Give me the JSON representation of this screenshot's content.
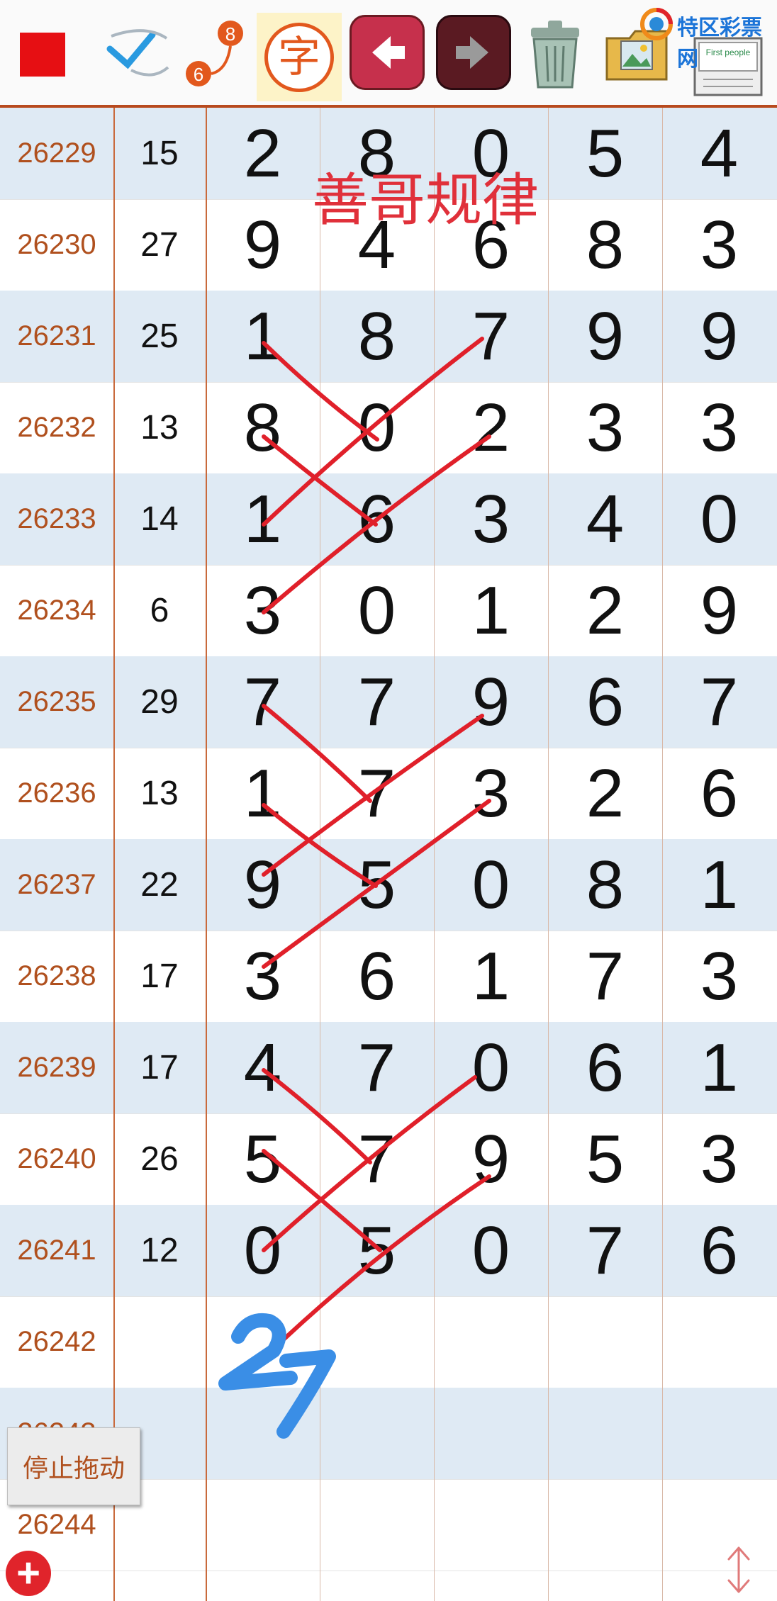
{
  "toolbar": {
    "items": [
      {
        "icon": "red-square-icon"
      },
      {
        "icon": "check-pen-icon"
      },
      {
        "icon": "range-icon",
        "label_top": "8",
        "label_bottom": "6"
      },
      {
        "icon": "character-icon",
        "label": "字"
      },
      {
        "icon": "back-arrow-icon"
      },
      {
        "icon": "forward-arrow-icon"
      },
      {
        "icon": "trash-icon"
      },
      {
        "icon": "photo-folder-icon"
      },
      {
        "icon": "notes-icon",
        "label": "First people"
      }
    ],
    "brand": "特区彩票网"
  },
  "overlay_title": "善哥规律",
  "handwritten_note": "27",
  "rows": [
    {
      "issue": "26229",
      "sum": "15",
      "d": [
        "2",
        "8",
        "0",
        "5",
        "4"
      ]
    },
    {
      "issue": "26230",
      "sum": "27",
      "d": [
        "9",
        "4",
        "6",
        "8",
        "3"
      ]
    },
    {
      "issue": "26231",
      "sum": "25",
      "d": [
        "1",
        "8",
        "7",
        "9",
        "9"
      ]
    },
    {
      "issue": "26232",
      "sum": "13",
      "d": [
        "8",
        "0",
        "2",
        "3",
        "3"
      ]
    },
    {
      "issue": "26233",
      "sum": "14",
      "d": [
        "1",
        "6",
        "3",
        "4",
        "0"
      ]
    },
    {
      "issue": "26234",
      "sum": "6",
      "d": [
        "3",
        "0",
        "1",
        "2",
        "9"
      ]
    },
    {
      "issue": "26235",
      "sum": "29",
      "d": [
        "7",
        "7",
        "9",
        "6",
        "7"
      ]
    },
    {
      "issue": "26236",
      "sum": "13",
      "d": [
        "1",
        "7",
        "3",
        "2",
        "6"
      ]
    },
    {
      "issue": "26237",
      "sum": "22",
      "d": [
        "9",
        "5",
        "0",
        "8",
        "1"
      ]
    },
    {
      "issue": "26238",
      "sum": "17",
      "d": [
        "3",
        "6",
        "1",
        "7",
        "3"
      ]
    },
    {
      "issue": "26239",
      "sum": "17",
      "d": [
        "4",
        "7",
        "0",
        "6",
        "1"
      ]
    },
    {
      "issue": "26240",
      "sum": "26",
      "d": [
        "5",
        "7",
        "9",
        "5",
        "3"
      ]
    },
    {
      "issue": "26241",
      "sum": "12",
      "d": [
        "0",
        "5",
        "0",
        "7",
        "6"
      ]
    },
    {
      "issue": "26242",
      "sum": "",
      "d": [
        "",
        "",
        "",
        "",
        ""
      ]
    },
    {
      "issue": "26243",
      "sum": "",
      "d": [
        "",
        "",
        "",
        "",
        ""
      ]
    },
    {
      "issue": "26244",
      "sum": "",
      "d": [
        "",
        "",
        "",
        "",
        ""
      ]
    }
  ],
  "buttons": {
    "stop_drag": "停止拖动",
    "add": "+"
  },
  "colors": {
    "accent": "#b84a1e",
    "issue_text": "#b0501e",
    "row_alt": "#dfeaf4",
    "annotation_red": "#e0303a",
    "annotation_blue": "#3a8ee6"
  }
}
